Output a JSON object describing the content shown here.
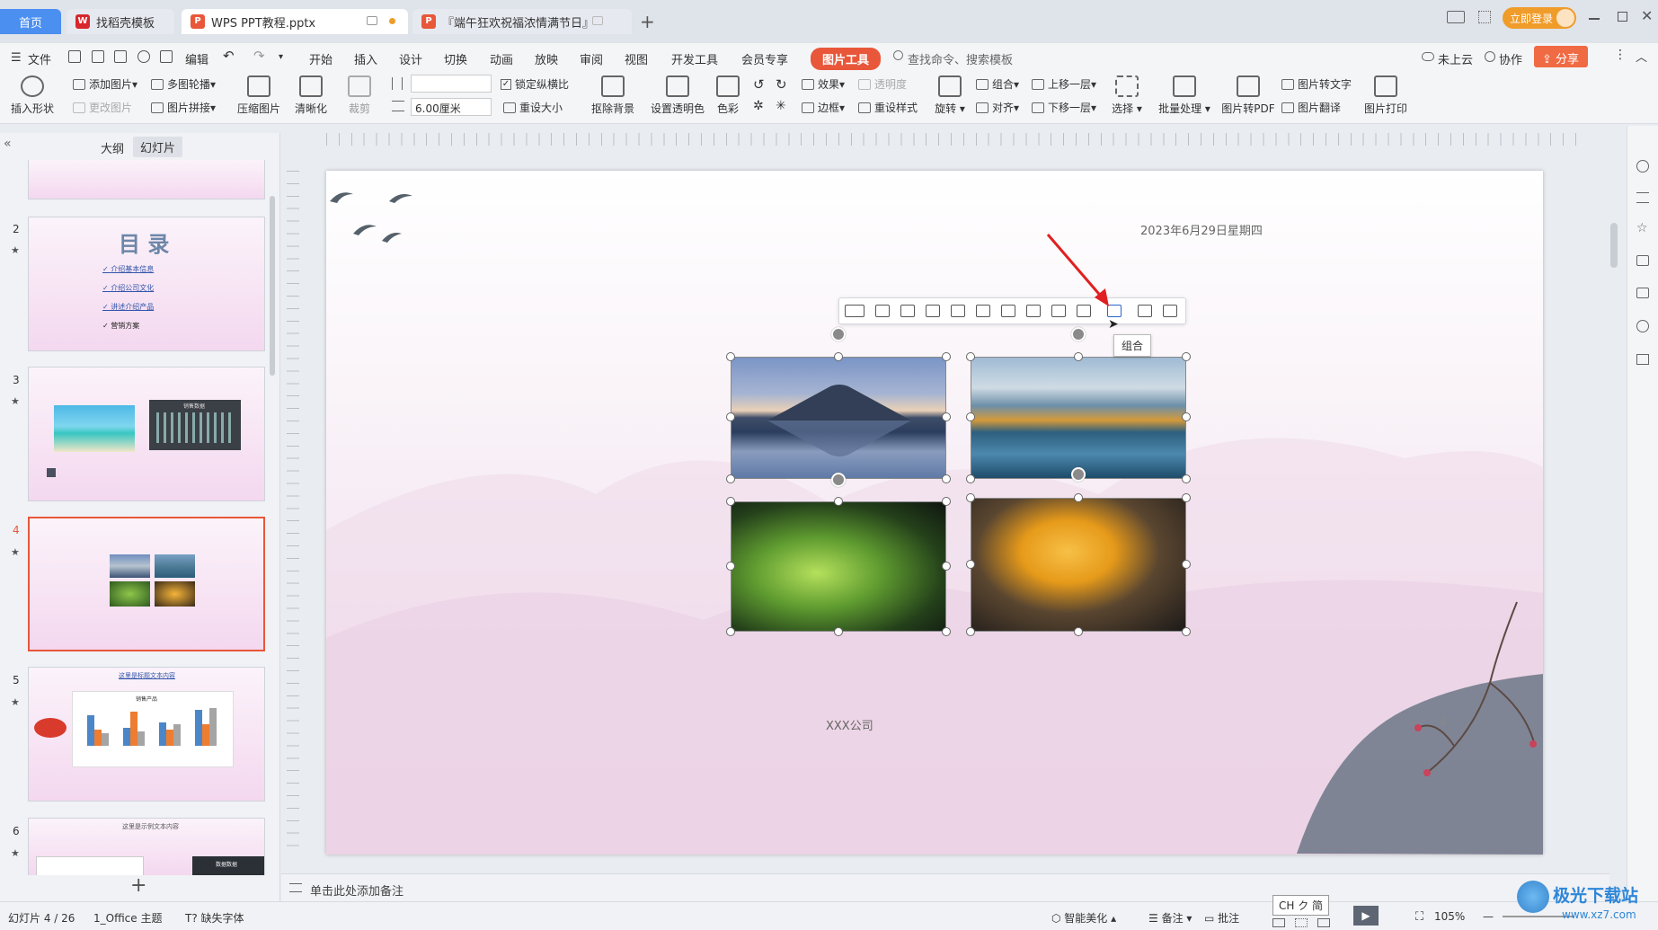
{
  "tabs": {
    "home": "首页",
    "template": "找稻壳模板",
    "doc": "WPS PPT教程.pptx",
    "doc2": "『端午狂欢祝福浓情满节日』",
    "new_tab": "+"
  },
  "titlebar": {
    "login": "立即登录"
  },
  "menu": {
    "file": "文件",
    "edit": "编辑",
    "items": [
      "开始",
      "插入",
      "设计",
      "切换",
      "动画",
      "放映",
      "审阅",
      "视图",
      "开发工具",
      "会员专享"
    ],
    "active_tool": "图片工具",
    "search": "查找命令、搜索模板",
    "cloud": "未上云",
    "collab": "协作",
    "share": "分享"
  },
  "ribbon": {
    "insert_shape": "插入形状",
    "add_image": "添加图片",
    "multi_outline": "多图轮播",
    "change_image": "更改图片",
    "image_collage": "图片拼接",
    "compress": "压缩图片",
    "sharpen": "清晰化",
    "crop": "裁剪",
    "height_value": "",
    "width_value": "6.00厘米",
    "lock_ratio": "锁定纵横比",
    "reset_size": "重设大小",
    "remove_bg": "抠除背景",
    "set_transparent": "设置透明色",
    "color": "色彩",
    "effect": "效果",
    "transparency": "透明度",
    "border": "边框",
    "reset_style": "重设样式",
    "rotate": "旋转",
    "group": "组合",
    "align": "对齐",
    "bring_forward": "上移一层",
    "send_backward": "下移一层",
    "select": "选择",
    "batch": "批量处理",
    "to_pdf": "图片转PDF",
    "to_text": "图片转文字",
    "translate": "图片翻译",
    "print": "图片打印"
  },
  "panel": {
    "outline_tab": "大纲",
    "slides_tab": "幻灯片",
    "slide_numbers": [
      "2",
      "3",
      "4",
      "5",
      "6"
    ],
    "slide2_title": "目 录",
    "slide2_items": [
      "介绍基本信息",
      "介绍公司文化",
      "讲述介绍产品",
      "营销方案"
    ],
    "slide3_chart_title": "销售数据",
    "slide5_title": "这里是标题文本内容",
    "slide5_chart_title": "销售产品",
    "slide6_title": "这里是示例文本内容",
    "slide6_label": "数据数据"
  },
  "slide": {
    "date": "2023年6月29日星期四",
    "company": "XXX公司",
    "page_number": "4",
    "tooltip": "组合"
  },
  "notes": {
    "placeholder": "单击此处添加备注"
  },
  "status": {
    "slide_info": "幻灯片 4 / 26",
    "theme": "1_Office 主题",
    "missing_font": "缺失字体",
    "smart_beautify": "智能美化",
    "notes": "备注",
    "comments": "批注",
    "ime": "CH ク 简",
    "zoom": "105%"
  },
  "watermark": {
    "site": "极光下载站",
    "url": "www.xz7.com"
  },
  "colors": {
    "accent": "#e8573a",
    "tab_active": "#ffffff",
    "home_tab": "#4b8ff0",
    "login": "#f09c2a",
    "share": "#f06a43"
  }
}
